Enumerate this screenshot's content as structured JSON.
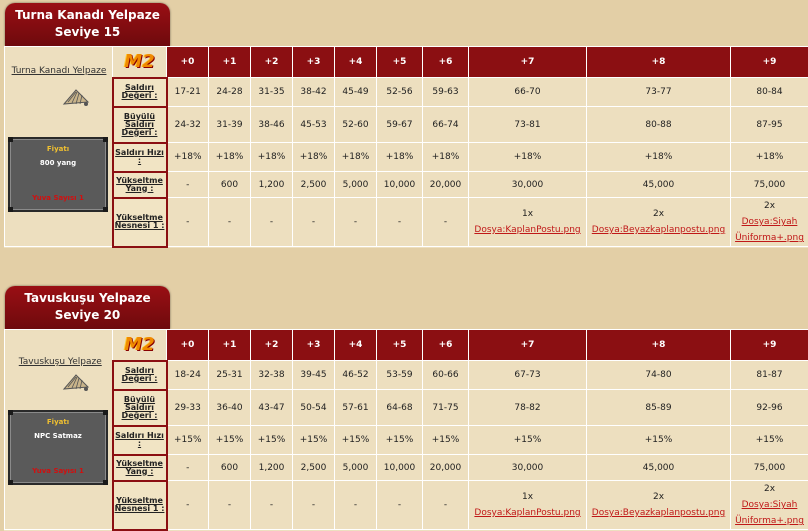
{
  "levels": [
    "+0",
    "+1",
    "+2",
    "+3",
    "+4",
    "+5",
    "+6",
    "+7",
    "+8",
    "+9"
  ],
  "logo_text": "M2",
  "row_labels": {
    "attack": "Saldırı Değeri :",
    "magic": "Büyülü Saldırı Değeri :",
    "speed": "Saldırı Hızı :",
    "yang": "Yükseltme Yang :",
    "item": "Yükseltme Nesnesi 1 :"
  },
  "items": [
    {
      "title": "Turna Kanadı Yelpaze",
      "level": "Seviye 15",
      "name": "Turna Kanadı Yelpaze",
      "price_title": "Fiyatı",
      "price": "800 yang",
      "price_note": "Yuva Sayısı 1",
      "attack": [
        "17-21",
        "24-28",
        "31-35",
        "38-42",
        "45-49",
        "52-56",
        "59-63",
        "66-70",
        "73-77",
        "80-84"
      ],
      "magic": [
        "24-32",
        "31-39",
        "38-46",
        "45-53",
        "52-60",
        "59-67",
        "66-74",
        "73-81",
        "80-88",
        "87-95"
      ],
      "speed": [
        "+18%",
        "+18%",
        "+18%",
        "+18%",
        "+18%",
        "+18%",
        "+18%",
        "+18%",
        "+18%",
        "+18%"
      ],
      "yang": [
        "-",
        "600",
        "1,200",
        "2,500",
        "5,000",
        "10,000",
        "20,000",
        "30,000",
        "45,000",
        "75,000"
      ],
      "item": [
        "-",
        "-",
        "-",
        "-",
        "-",
        "-",
        "-"
      ],
      "upgrade7": {
        "count": "1x",
        "link": "Dosya:KaplanPostu.png"
      },
      "upgrade8": {
        "count": "2x",
        "link": "Dosya:Beyazkaplanpostu.png"
      },
      "upgrade9": {
        "count": "2x",
        "link": "Dosya:Siyah Üniforma+.png"
      }
    },
    {
      "title": "Tavuskuşu Yelpaze",
      "level": "Seviye 20",
      "name": "Tavuskuşu Yelpaze",
      "price_title": "Fiyatı",
      "price": "NPC Satmaz",
      "price_note": "Yuva Sayısı 1",
      "attack": [
        "18-24",
        "25-31",
        "32-38",
        "39-45",
        "46-52",
        "53-59",
        "60-66",
        "67-73",
        "74-80",
        "81-87"
      ],
      "magic": [
        "29-33",
        "36-40",
        "43-47",
        "50-54",
        "57-61",
        "64-68",
        "71-75",
        "78-82",
        "85-89",
        "92-96"
      ],
      "speed": [
        "+15%",
        "+15%",
        "+15%",
        "+15%",
        "+15%",
        "+15%",
        "+15%",
        "+15%",
        "+15%",
        "+15%"
      ],
      "yang": [
        "-",
        "600",
        "1,200",
        "2,500",
        "5,000",
        "10,000",
        "20,000",
        "30,000",
        "45,000",
        "75,000"
      ],
      "item": [
        "-",
        "-",
        "-",
        "-",
        "-",
        "-",
        "-"
      ],
      "upgrade7": {
        "count": "1x",
        "link": "Dosya:KaplanPostu.png"
      },
      "upgrade8": {
        "count": "2x",
        "link": "Dosya:Beyazkaplanpostu.png"
      },
      "upgrade9": {
        "count": "2x",
        "link": "Dosya:Siyah Üniforma+.png"
      }
    }
  ]
}
